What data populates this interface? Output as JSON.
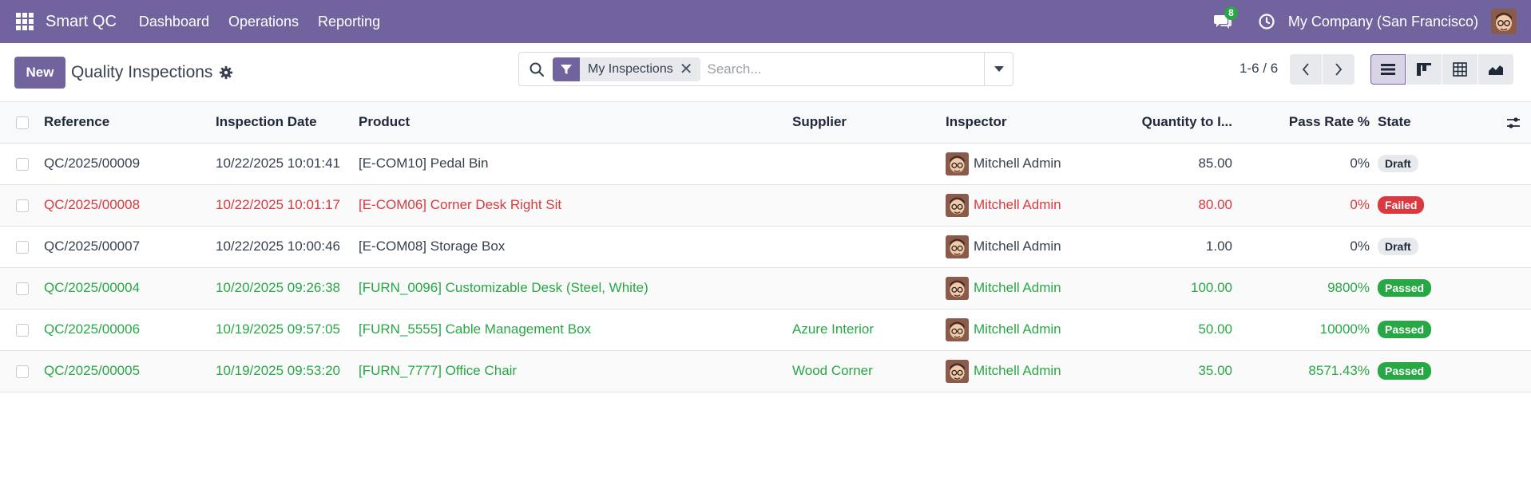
{
  "navbar": {
    "brand": "Smart QC",
    "menu": [
      "Dashboard",
      "Operations",
      "Reporting"
    ],
    "chat_count": "8",
    "company": "My Company (San Francisco)",
    "accent": "#71639e"
  },
  "control": {
    "new_label": "New",
    "title": "Quality Inspections",
    "facet": "My Inspections",
    "search_placeholder": "Search...",
    "pager": "1-6 / 6"
  },
  "table": {
    "columns": [
      "Reference",
      "Inspection Date",
      "Product",
      "Supplier",
      "Inspector",
      "Quantity to I...",
      "Pass Rate %",
      "State"
    ],
    "rows": [
      {
        "reference": "QC/2025/00009",
        "date": "10/22/2025 10:01:41",
        "product": "[E-COM10] Pedal Bin",
        "supplier": "",
        "inspector": "Mitchell Admin",
        "quantity": "85.00",
        "pass_rate": "0%",
        "state": "Draft",
        "status": "draft"
      },
      {
        "reference": "QC/2025/00008",
        "date": "10/22/2025 10:01:17",
        "product": "[E-COM06] Corner Desk Right Sit",
        "supplier": "",
        "inspector": "Mitchell Admin",
        "quantity": "80.00",
        "pass_rate": "0%",
        "state": "Failed",
        "status": "failed"
      },
      {
        "reference": "QC/2025/00007",
        "date": "10/22/2025 10:00:46",
        "product": "[E-COM08] Storage Box",
        "supplier": "",
        "inspector": "Mitchell Admin",
        "quantity": "1.00",
        "pass_rate": "0%",
        "state": "Draft",
        "status": "draft"
      },
      {
        "reference": "QC/2025/00004",
        "date": "10/20/2025 09:26:38",
        "product": "[FURN_0096] Customizable Desk (Steel, White)",
        "supplier": "",
        "inspector": "Mitchell Admin",
        "quantity": "100.00",
        "pass_rate": "9800%",
        "state": "Passed",
        "status": "passed"
      },
      {
        "reference": "QC/2025/00006",
        "date": "10/19/2025 09:57:05",
        "product": "[FURN_5555] Cable Management Box",
        "supplier": "Azure Interior",
        "inspector": "Mitchell Admin",
        "quantity": "50.00",
        "pass_rate": "10000%",
        "state": "Passed",
        "status": "passed"
      },
      {
        "reference": "QC/2025/00005",
        "date": "10/19/2025 09:53:20",
        "product": "[FURN_7777] Office Chair",
        "supplier": "Wood Corner",
        "inspector": "Mitchell Admin",
        "quantity": "35.00",
        "pass_rate": "8571.43%",
        "state": "Passed",
        "status": "passed"
      }
    ],
    "status_colors": {
      "draft": "#374151",
      "failed": "#d9393f",
      "passed": "#28a745"
    }
  }
}
